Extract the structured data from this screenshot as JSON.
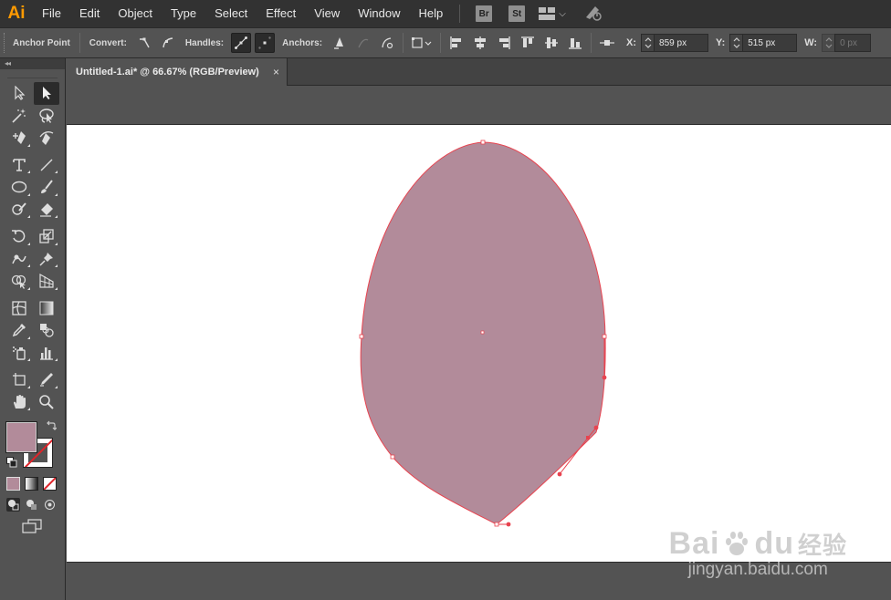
{
  "app": {
    "logo_text": "Ai",
    "accent_color": "#ff9a00"
  },
  "menubar": {
    "items": [
      "File",
      "Edit",
      "Object",
      "Type",
      "Select",
      "Effect",
      "View",
      "Window",
      "Help"
    ],
    "bridge_badge": "Br",
    "stock_badge": "St"
  },
  "controlbar": {
    "tool_name": "Anchor Point",
    "convert_label": "Convert:",
    "handles_label": "Handles:",
    "anchors_label": "Anchors:",
    "x_label": "X:",
    "x_value": "859 px",
    "y_label": "Y:",
    "y_value": "515 px",
    "w_label": "W:",
    "w_value": "0 px"
  },
  "toolpanel": {
    "collapse_glyph": "◂◂",
    "fill_color": "#b28b9a",
    "stroke_color": "none"
  },
  "document": {
    "tab_title": "Untitled-1.ai* @ 66.67% (RGB/Preview)",
    "close_glyph": "×"
  },
  "artwork": {
    "shape_fill": "#b28b9a",
    "path_color": "#e8434f"
  },
  "watermark": {
    "logo_text": "Bai",
    "logo_suffix": "du",
    "logo_cn": "经验",
    "url": "jingyan.baidu.com"
  }
}
